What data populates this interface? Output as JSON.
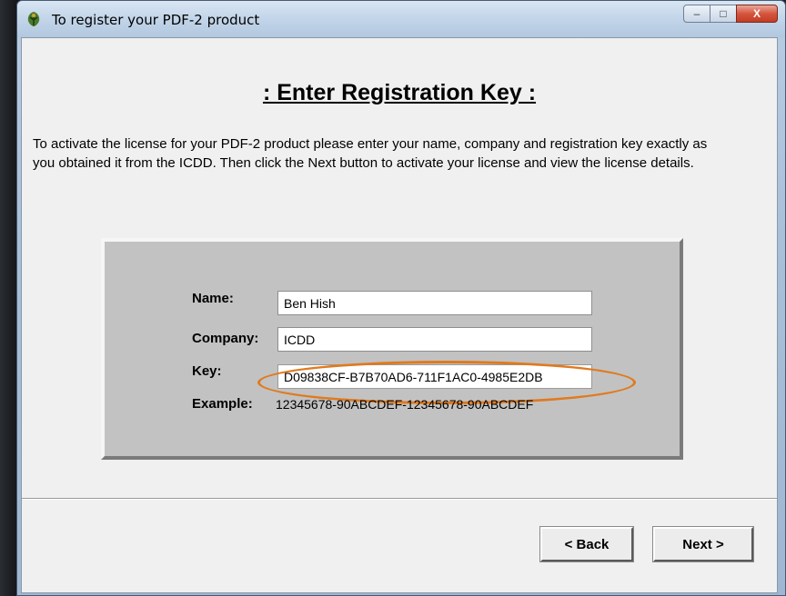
{
  "window": {
    "title": "To register your PDF-2 product",
    "controls": {
      "minimize": "–",
      "maximize": "□",
      "close": "X"
    }
  },
  "page": {
    "heading": ": Enter Registration Key :",
    "description": "To activate the license for your PDF-2 product please enter your name, company and registration key exactly as you obtained it from the ICDD.  Then click the Next button to activate your license and view the license details."
  },
  "form": {
    "name_label": "Name:",
    "name_value": "Ben Hish",
    "company_label": "Company:",
    "company_value": "ICDD",
    "key_label": "Key:",
    "key_value": "D09838CF-B7B70AD6-711F1AC0-4985E2DB",
    "example_label": "Example:",
    "example_value": "12345678-90ABCDEF-12345678-90ABCDEF"
  },
  "buttons": {
    "back": "< Back",
    "next": "Next >"
  },
  "colors": {
    "highlight_ring": "#e07a1e",
    "panel_bg": "#c2c2c2"
  }
}
